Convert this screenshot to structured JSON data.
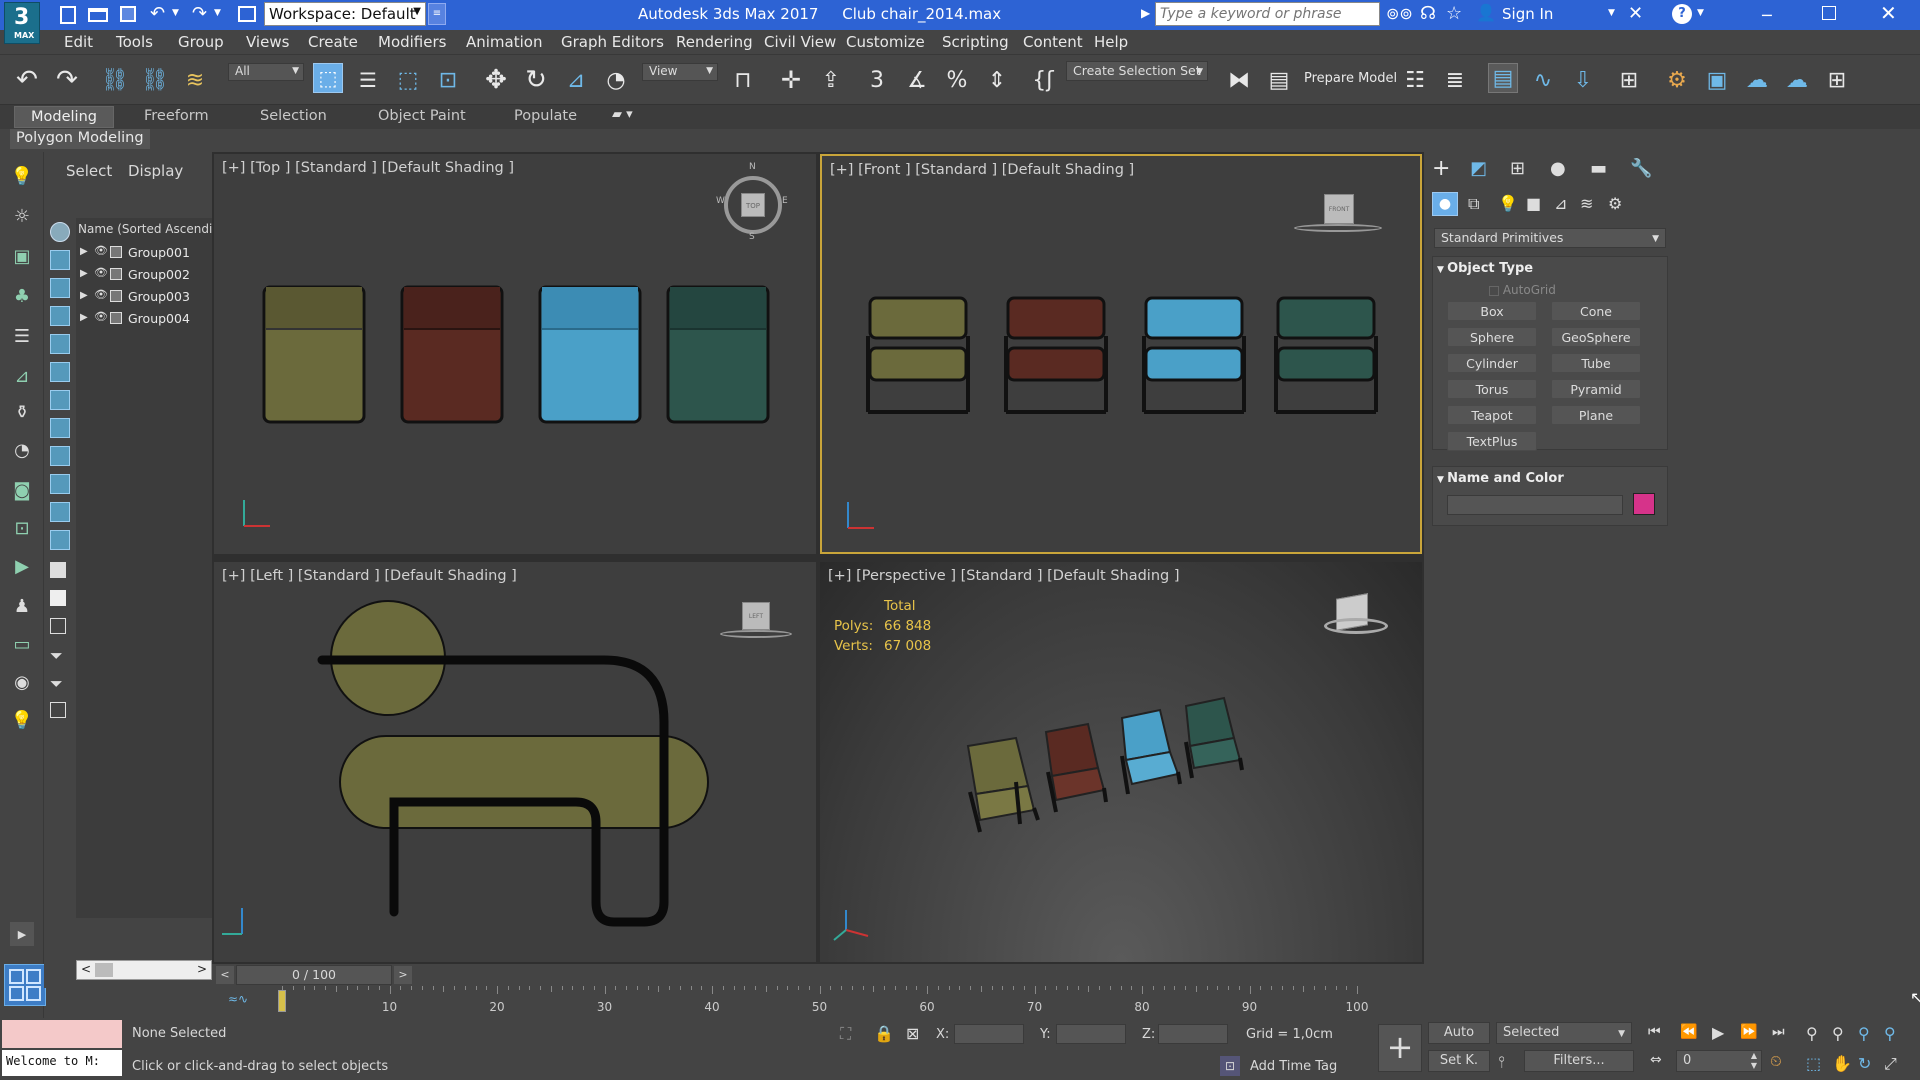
{
  "titlebar": {
    "logo": "3",
    "logo_sub": "MAX",
    "workspace": "Workspace: Default",
    "title": "Autodesk 3ds Max 2017     Club chair_2014.max",
    "search_placeholder": "Type a keyword or phrase",
    "sign_in": "Sign In"
  },
  "menu": [
    "Edit",
    "Tools",
    "Group",
    "Views",
    "Create",
    "Modifiers",
    "Animation",
    "Graph Editors",
    "Rendering",
    "Civil View",
    "Customize",
    "Scripting",
    "Content",
    "Help"
  ],
  "toolbar": {
    "filter": "All",
    "view": "View",
    "create_selection_set": "Create Selection Set",
    "prepare_model": "Prepare Model"
  },
  "ribbon": {
    "tabs": [
      "Modeling",
      "Freeform",
      "Selection",
      "Object Paint",
      "Populate"
    ],
    "sub": "Polygon Modeling"
  },
  "scene_explorer": {
    "tabs": [
      "Select",
      "Display"
    ],
    "header": "Name (Sorted Ascendi",
    "rows": [
      "Group001",
      "Group002",
      "Group003",
      "Group004"
    ]
  },
  "viewports": {
    "top": "[+] [Top ] [Standard ] [Default Shading ]",
    "front": "[+] [Front ] [Standard ] [Default Shading ]",
    "left": "[+] [Left ] [Standard ] [Default Shading ]",
    "perspective": "[+] [Perspective ] [Standard ] [Default Shading ]",
    "stats": {
      "total": "Total",
      "polys_label": "Polys:",
      "polys": "66 848",
      "verts_label": "Verts:",
      "verts": "67 008"
    },
    "compass": {
      "n": "N",
      "s": "S",
      "e": "E",
      "w": "W",
      "top": "TOP"
    },
    "viewcube_front": "FRONT",
    "viewcube_left": "LEFT"
  },
  "command_panel": {
    "dropdown": "Standard Primitives",
    "object_type": "Object Type",
    "autogrid": "AutoGrid",
    "buttons": [
      "Box",
      "Cone",
      "Sphere",
      "GeoSphere",
      "Cylinder",
      "Tube",
      "Torus",
      "Pyramid",
      "Teapot",
      "Plane",
      "TextPlus"
    ],
    "name_and_color": "Name and Color",
    "color": "#d6338a"
  },
  "timeline": {
    "slider": "0 / 100",
    "ticks": [
      "10",
      "20",
      "30",
      "40",
      "50",
      "60",
      "70",
      "80",
      "90",
      "100"
    ]
  },
  "status": {
    "welcome": "Welcome to M:",
    "none_selected": "None Selected",
    "prompt": "Click or click-and-drag to select objects",
    "x": "X:",
    "y": "Y:",
    "z": "Z:",
    "grid": "Grid = 1,0cm",
    "add_time_tag": "Add Time Tag",
    "auto": "Auto",
    "selected": "Selected",
    "setk": "Set K.",
    "filters": "Filters...",
    "frame": "0"
  },
  "colors": {
    "titlebar": "#2d63d4",
    "olive": "#6b6a3c",
    "brown": "#5a2a22",
    "blue": "#3d95bf",
    "green": "#2a4d45"
  }
}
